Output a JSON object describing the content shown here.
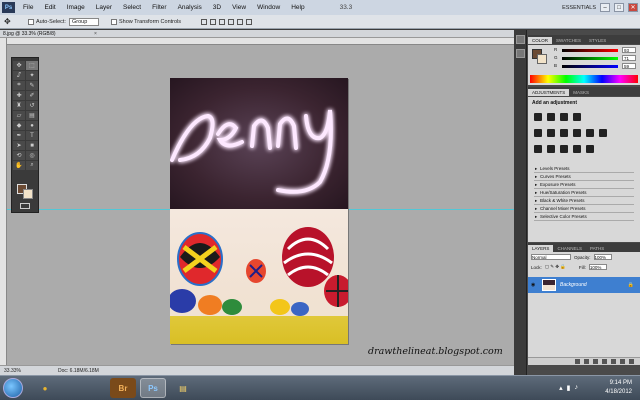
{
  "app": {
    "logo": "Ps",
    "menu": [
      "File",
      "Edit",
      "Image",
      "Layer",
      "Select",
      "Filter",
      "Analysis",
      "3D",
      "View",
      "Window",
      "Help"
    ],
    "zoom_readout": "33.3",
    "workspace": "ESSENTIALS",
    "win_min": "–",
    "win_max": "□",
    "win_close": "✕"
  },
  "options": {
    "auto_select_label": "Auto-Select:",
    "auto_select_value": "Group",
    "transform_label": "Show Transform Controls"
  },
  "document": {
    "tab_title": "8.jpg @ 33.3% (RGB/8)",
    "tab_close": "×",
    "zoom": "33.33%",
    "doc_size": "Doc: 6.18M/6.18M"
  },
  "credit": "drawthelineat.blogspot.com",
  "photo": {
    "handwriting": "Jenny"
  },
  "panels": {
    "color_tabs": [
      "COLOR",
      "SWATCHES",
      "STYLES"
    ],
    "color_channels": [
      {
        "label": "R",
        "value": "93"
      },
      {
        "label": "G",
        "value": "71"
      },
      {
        "label": "B",
        "value": "59"
      }
    ],
    "adj_tabs": [
      "ADJUSTMENTS",
      "MASKS"
    ],
    "adj_title": "Add an adjustment",
    "presets": [
      "Levels Presets",
      "Curves Presets",
      "Exposure Presets",
      "Hue/Saturation Presets",
      "Black & White Presets",
      "Channel Mixer Presets",
      "Selective Color Presets"
    ],
    "layer_tabs": [
      "LAYERS",
      "CHANNELS",
      "PATHS"
    ],
    "blend_mode": "Normal",
    "opacity_label": "Opacity:",
    "opacity_value": "100%",
    "lock_label": "Lock:",
    "fill_label": "Fill:",
    "fill_value": "100%",
    "layer_name": "Background"
  },
  "taskbar": {
    "apps": [
      "Chrome",
      "Bridge",
      "Photoshop",
      "Explorer"
    ],
    "app_glyphs": [
      "●",
      "Br",
      "Ps",
      "▤"
    ],
    "time": "9:14 PM",
    "date": "4/18/2012"
  },
  "colors": {
    "foreground": "#6b4a33",
    "background": "#f2e3c9",
    "layer_highlight": "#3e7fd0",
    "guide": "#53c7d6"
  }
}
